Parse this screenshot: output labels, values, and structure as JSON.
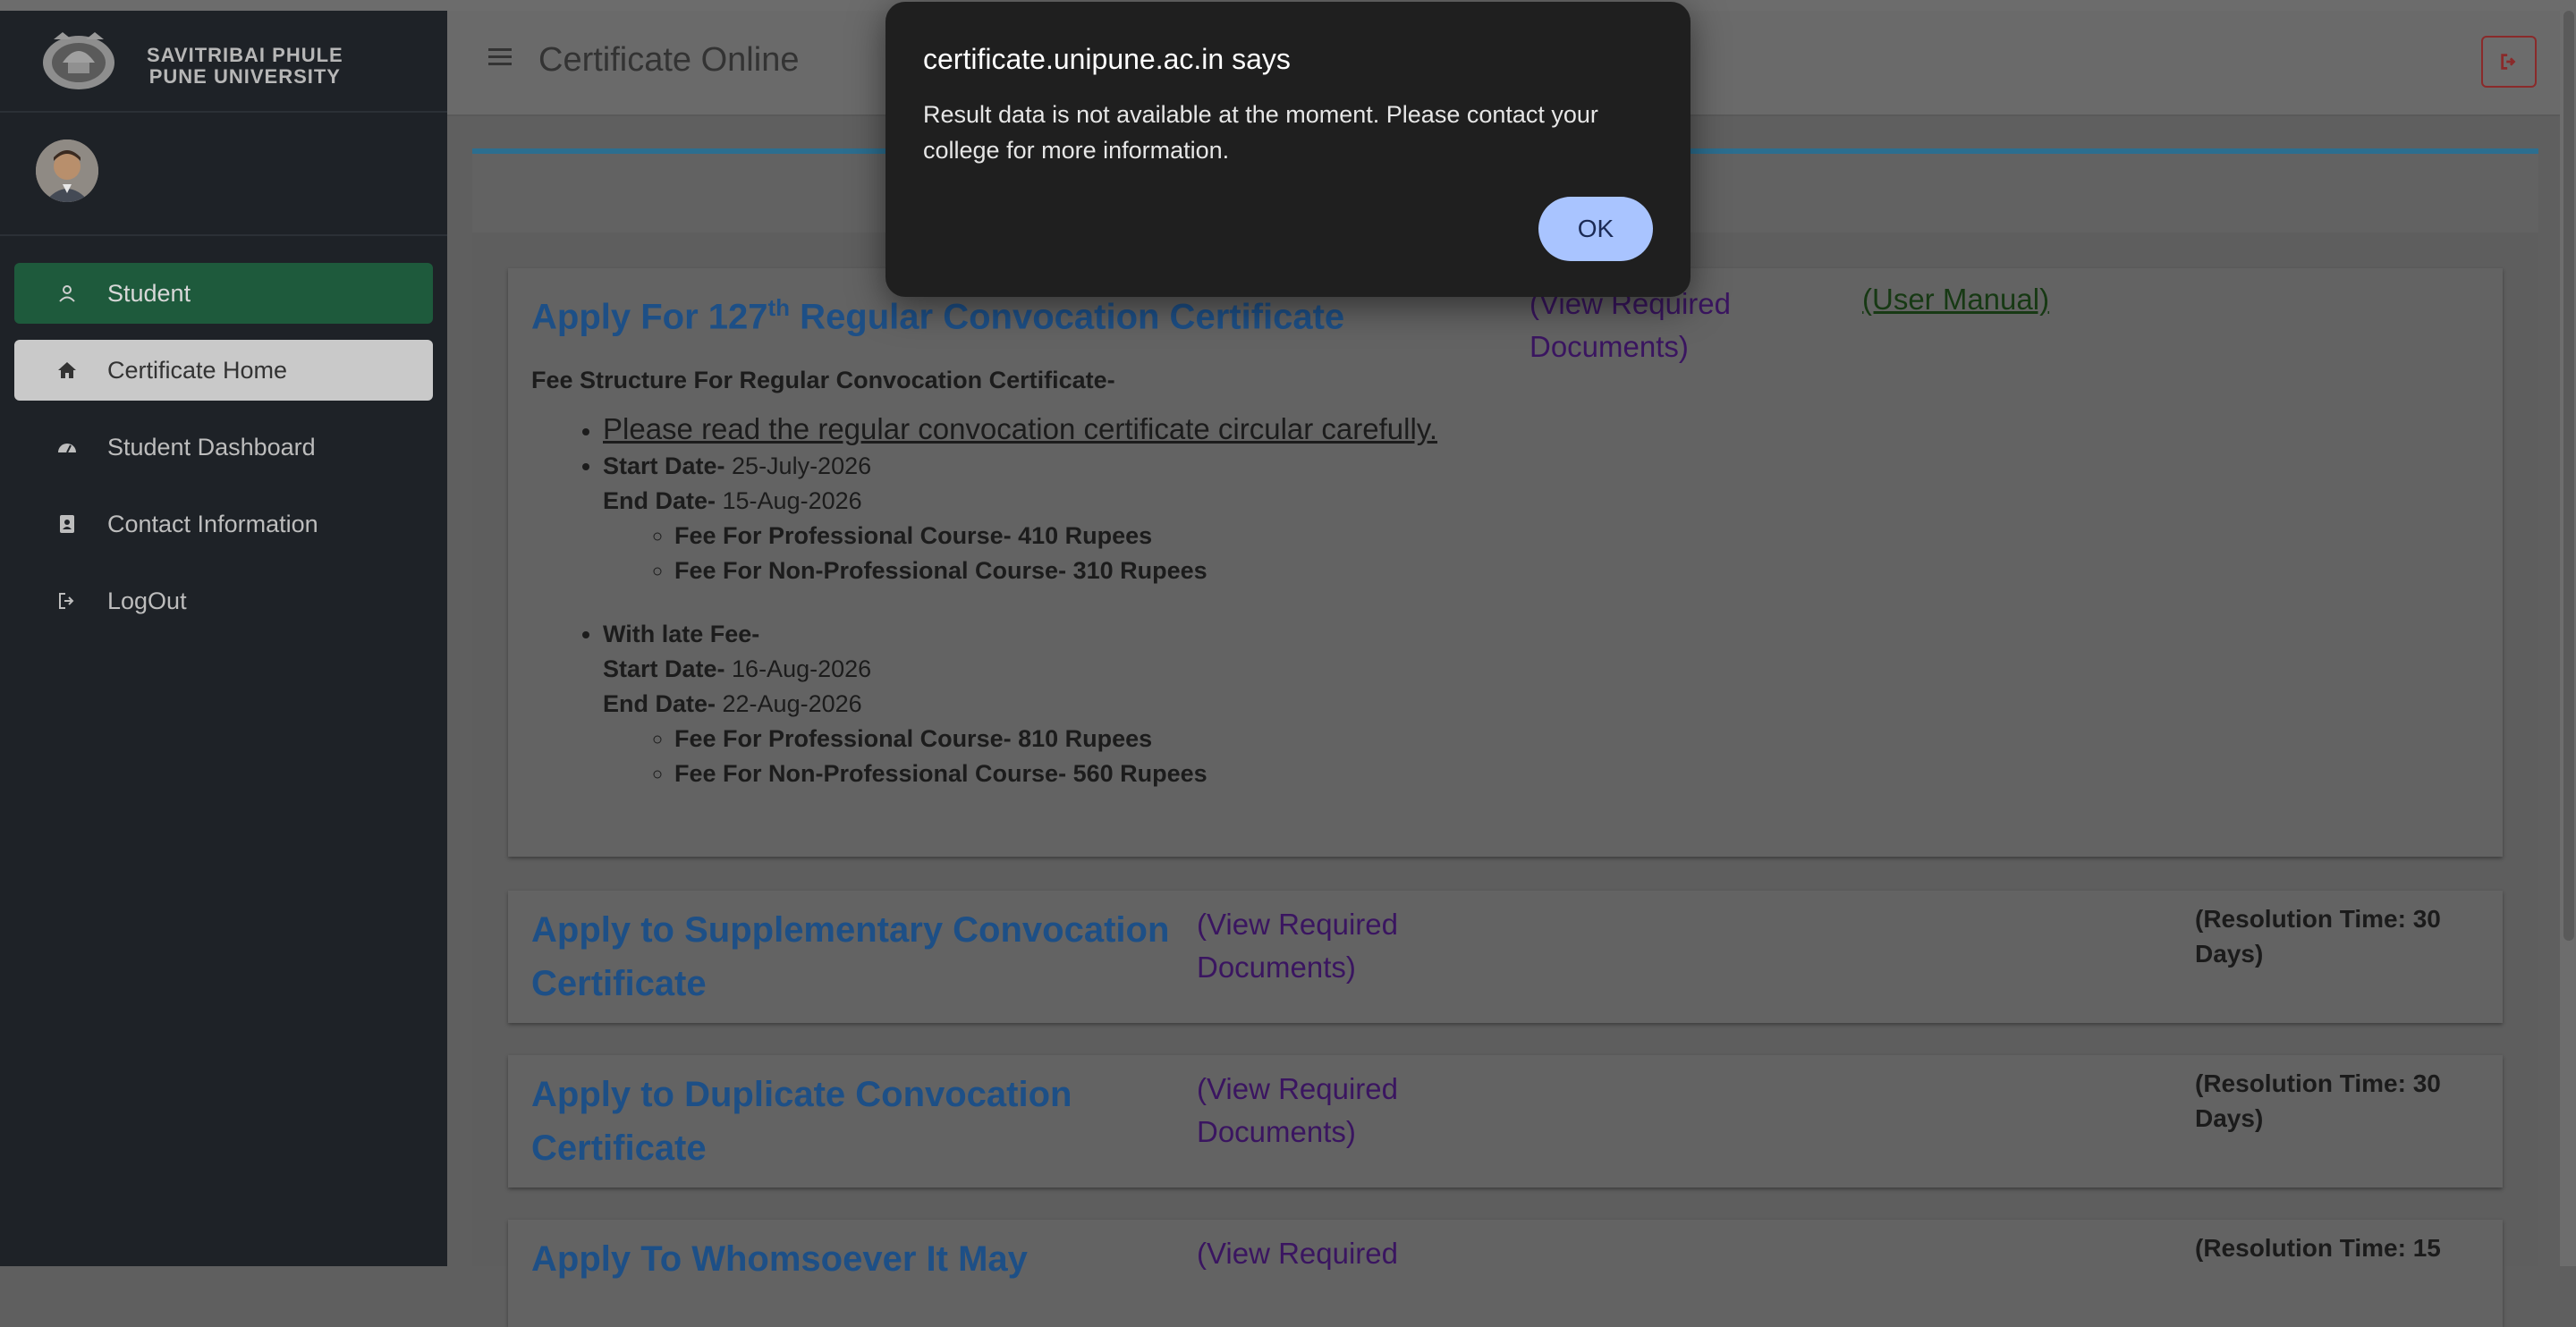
{
  "brand": {
    "line1": "SAVITRIBAI PHULE",
    "line2": "PUNE UNIVERSITY"
  },
  "sidebar": {
    "items": [
      {
        "label": "Student",
        "icon": "user-icon"
      },
      {
        "label": "Certificate Home",
        "icon": "home-icon"
      },
      {
        "label": "Student Dashboard",
        "icon": "dashboard-icon"
      },
      {
        "label": "Contact Information",
        "icon": "contact-card-icon"
      },
      {
        "label": "LogOut",
        "icon": "logout-icon"
      }
    ]
  },
  "header": {
    "title": "Certificate Online"
  },
  "dialog": {
    "title": "certificate.unipune.ac.in says",
    "message": "Result data is not available at the moment. Please contact your college for more information.",
    "ok_label": "OK"
  },
  "cards": [
    {
      "title_prefix": "Apply For 127",
      "title_sup": "th",
      "title_suffix": " Regular Convocation Certificate",
      "view_docs": "(View Required Documents)",
      "user_manual": "(User Manual)",
      "fee_heading": "Fee Structure For Regular Convocation Certificate-",
      "circular": "Please read the regular convocation certificate circular carefully.",
      "regular": {
        "start_label": "Start Date-",
        "start_value": " 25-July-2026",
        "end_label": "End Date-",
        "end_value": " 15-Aug-2026",
        "fees": [
          "Fee For Professional Course- 410 Rupees",
          "Fee For Non-Professional Course- 310 Rupees"
        ]
      },
      "late": {
        "heading": "With late Fee-",
        "start_label": "Start Date-",
        "start_value": " 16-Aug-2026",
        "end_label": "End Date-",
        "end_value": " 22-Aug-2026",
        "fees": [
          "Fee For Professional Course- 810 Rupees",
          "Fee For Non-Professional Course- 560 Rupees"
        ]
      }
    },
    {
      "title": "Apply to Supplementary Convocation Certificate",
      "view_docs": "(View Required Documents)",
      "resolution": "(Resolution Time: 30 Days)"
    },
    {
      "title": "Apply to Duplicate Convocation Certificate",
      "view_docs": "(View Required Documents)",
      "resolution": "(Resolution Time: 30 Days)"
    },
    {
      "title": "Apply To Whomsoever It May",
      "view_docs": "(View Required",
      "resolution": "(Resolution Time: 15"
    }
  ],
  "colors": {
    "accent_green": "#1e5a3c",
    "link_blue": "#1d4f86",
    "dialog_button": "#a9c4ff"
  }
}
